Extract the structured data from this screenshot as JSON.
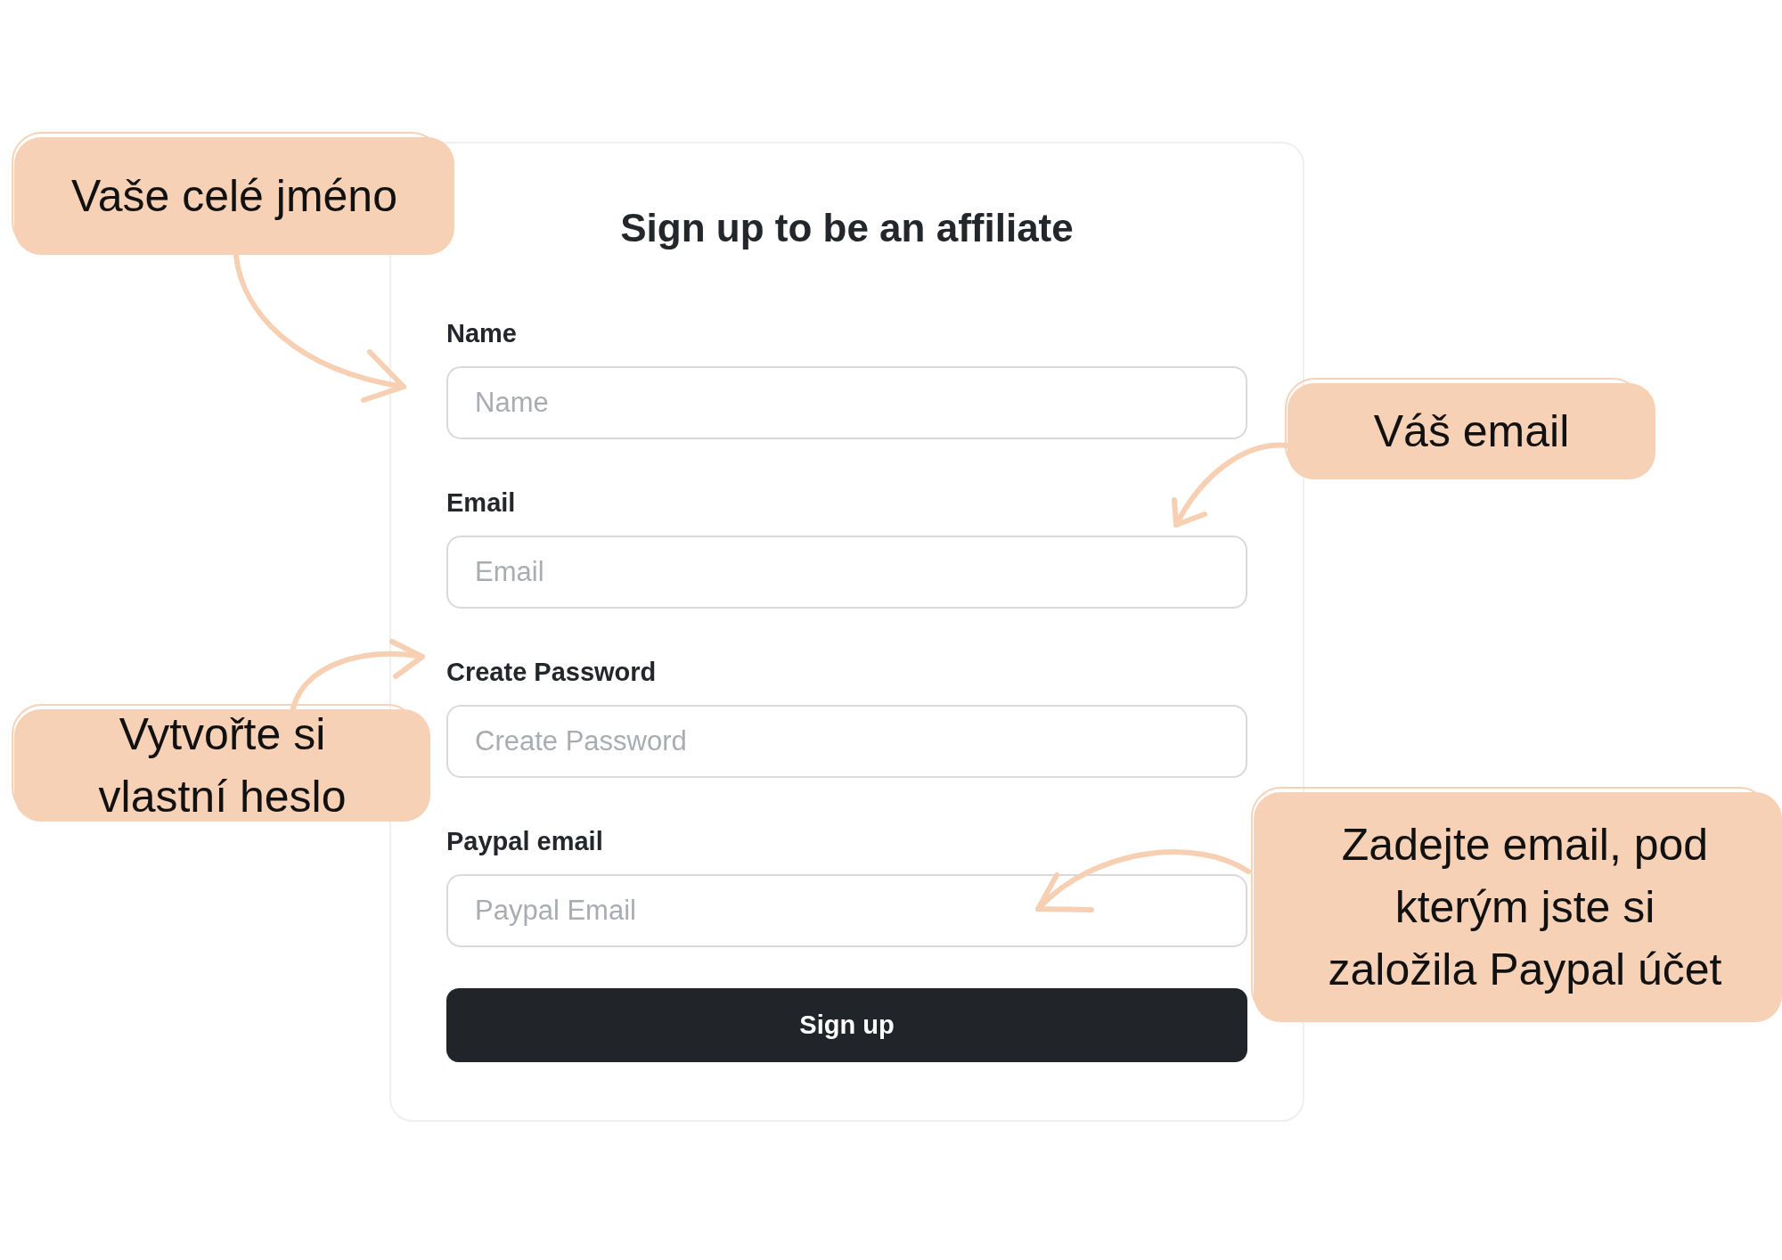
{
  "form": {
    "title": "Sign up to be an affiliate",
    "fields": [
      {
        "label": "Name",
        "placeholder": "Name"
      },
      {
        "label": "Email",
        "placeholder": "Email"
      },
      {
        "label": "Create Password",
        "placeholder": "Create Password"
      },
      {
        "label": "Paypal email",
        "placeholder": "Paypal Email"
      }
    ],
    "submit_button": "Sign up"
  },
  "annotations": [
    {
      "text": "Vaše celé jméno"
    },
    {
      "text": "Váš email"
    },
    {
      "text": "Vytvořte si vlastní heslo"
    },
    {
      "text": "Zadejte email, pod kterým jste si založila Paypal účet"
    }
  ]
}
